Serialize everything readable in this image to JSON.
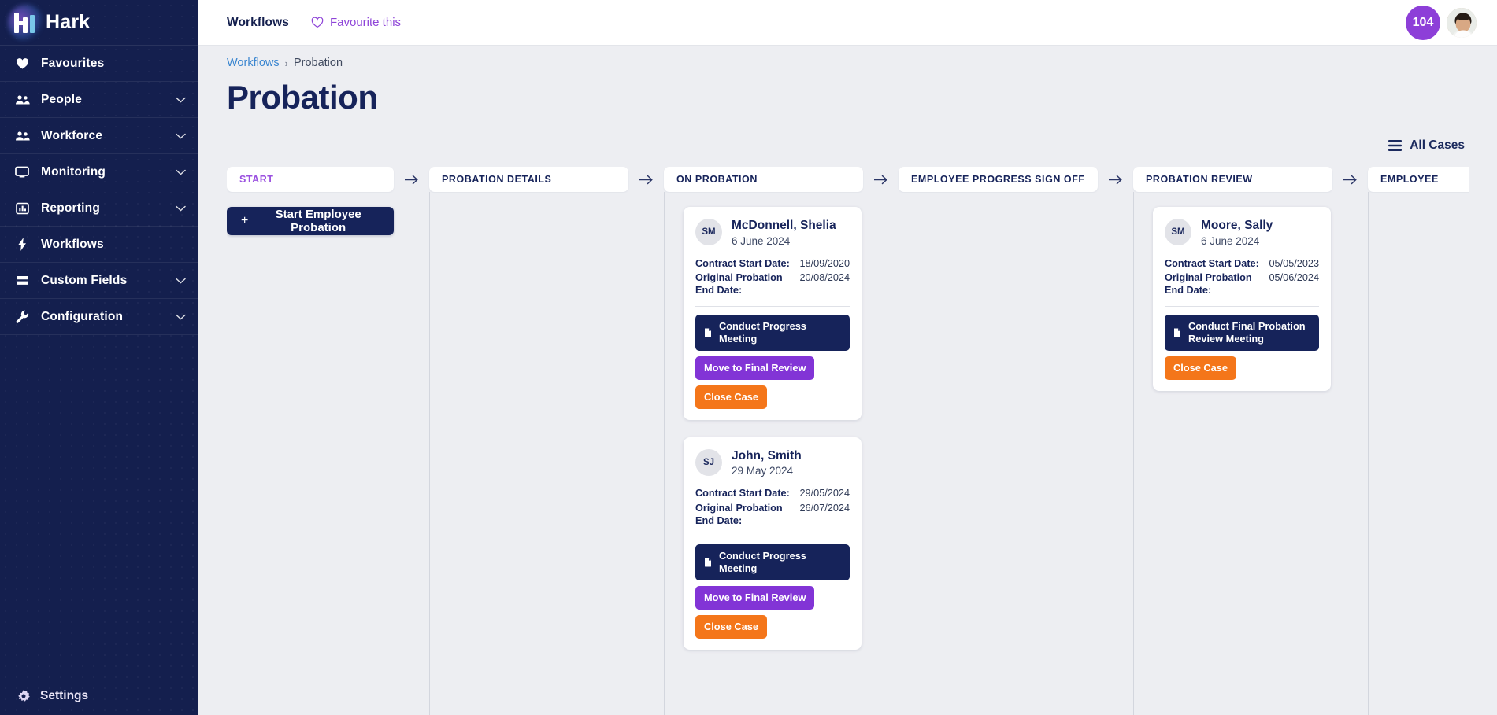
{
  "brand": {
    "name": "Hark",
    "logo_icon": "hark-logo-icon"
  },
  "sidebar": {
    "items": [
      {
        "label": "Favourites",
        "icon": "heart-icon",
        "expandable": false
      },
      {
        "label": "People",
        "icon": "people-icon",
        "expandable": true
      },
      {
        "label": "Workforce",
        "icon": "people-icon",
        "expandable": true
      },
      {
        "label": "Monitoring",
        "icon": "monitor-icon",
        "expandable": true
      },
      {
        "label": "Reporting",
        "icon": "bar-chart-icon",
        "expandable": true
      },
      {
        "label": "Workflows",
        "icon": "lightning-icon",
        "expandable": false
      },
      {
        "label": "Custom Fields",
        "icon": "list-icon",
        "expandable": true
      },
      {
        "label": "Configuration",
        "icon": "wrench-icon",
        "expandable": true
      }
    ],
    "settings": {
      "label": "Settings",
      "icon": "gear-icon"
    }
  },
  "topbar": {
    "title": "Workflows",
    "favourite_label": "Favourite this",
    "favourite_icon": "heart-outline-icon",
    "notification_count": "104",
    "avatar_icon": "user-avatar"
  },
  "breadcrumb": {
    "parent": "Workflows",
    "separator": "›",
    "current": "Probation"
  },
  "page": {
    "title": "Probation"
  },
  "toolbar": {
    "all_cases_label": "All Cases",
    "all_cases_icon": "list-menu-icon"
  },
  "board": {
    "arrow_icon": "arrow-right-icon",
    "columns": [
      {
        "id": "start",
        "title": "START",
        "highlight": true,
        "action_button": {
          "label": "Start Employee Probation",
          "icon": "plus-icon"
        },
        "cards": []
      },
      {
        "id": "probation-details",
        "title": "PROBATION DETAILS",
        "highlight": false,
        "cards": []
      },
      {
        "id": "on-probation",
        "title": "ON PROBATION",
        "highlight": false,
        "cards": [
          {
            "initials": "SM",
            "name": "McDonnell, Shelia",
            "date": "6 June 2024",
            "fields": [
              {
                "label": "Contract Start Date:",
                "value": "18/09/2020"
              },
              {
                "label": "Original Probation End Date:",
                "value": "20/08/2024"
              }
            ],
            "actions": [
              {
                "label": "Conduct Progress Meeting",
                "style": "dark",
                "icon": "document-icon"
              },
              {
                "label": "Move to Final Review",
                "style": "purple",
                "icon": null
              },
              {
                "label": "Close Case",
                "style": "orange",
                "icon": null
              }
            ]
          },
          {
            "initials": "SJ",
            "name": "John, Smith",
            "date": "29 May 2024",
            "fields": [
              {
                "label": "Contract Start Date:",
                "value": "29/05/2024"
              },
              {
                "label": "Original Probation End Date:",
                "value": "26/07/2024"
              }
            ],
            "actions": [
              {
                "label": "Conduct Progress Meeting",
                "style": "dark",
                "icon": "document-icon"
              },
              {
                "label": "Move to Final Review",
                "style": "purple",
                "icon": null
              },
              {
                "label": "Close Case",
                "style": "orange",
                "icon": null
              }
            ]
          }
        ]
      },
      {
        "id": "employee-progress-sign-off",
        "title": "EMPLOYEE PROGRESS SIGN OFF",
        "highlight": false,
        "cards": []
      },
      {
        "id": "probation-review",
        "title": "PROBATION REVIEW",
        "highlight": false,
        "cards": [
          {
            "initials": "SM",
            "name": "Moore, Sally",
            "date": "6 June 2024",
            "fields": [
              {
                "label": "Contract Start Date:",
                "value": "05/05/2023"
              },
              {
                "label": "Original Probation End Date:",
                "value": "05/06/2024"
              }
            ],
            "actions": [
              {
                "label": "Conduct Final Probation Review Meeting",
                "style": "dark",
                "icon": "document-icon"
              },
              {
                "label": "Close Case",
                "style": "orange",
                "icon": null
              }
            ]
          }
        ]
      },
      {
        "id": "employee-final",
        "title": "EMPLOYEE",
        "highlight": false,
        "clipped": true,
        "cards": []
      }
    ]
  },
  "colors": {
    "sidebar_bg": "#141f4e",
    "navy": "#16235a",
    "purple": "#8234d6",
    "orange": "#f4761a",
    "accent_link": "#3b86d0",
    "badge": "#8d3fd8",
    "page_bg": "#edeef2"
  }
}
